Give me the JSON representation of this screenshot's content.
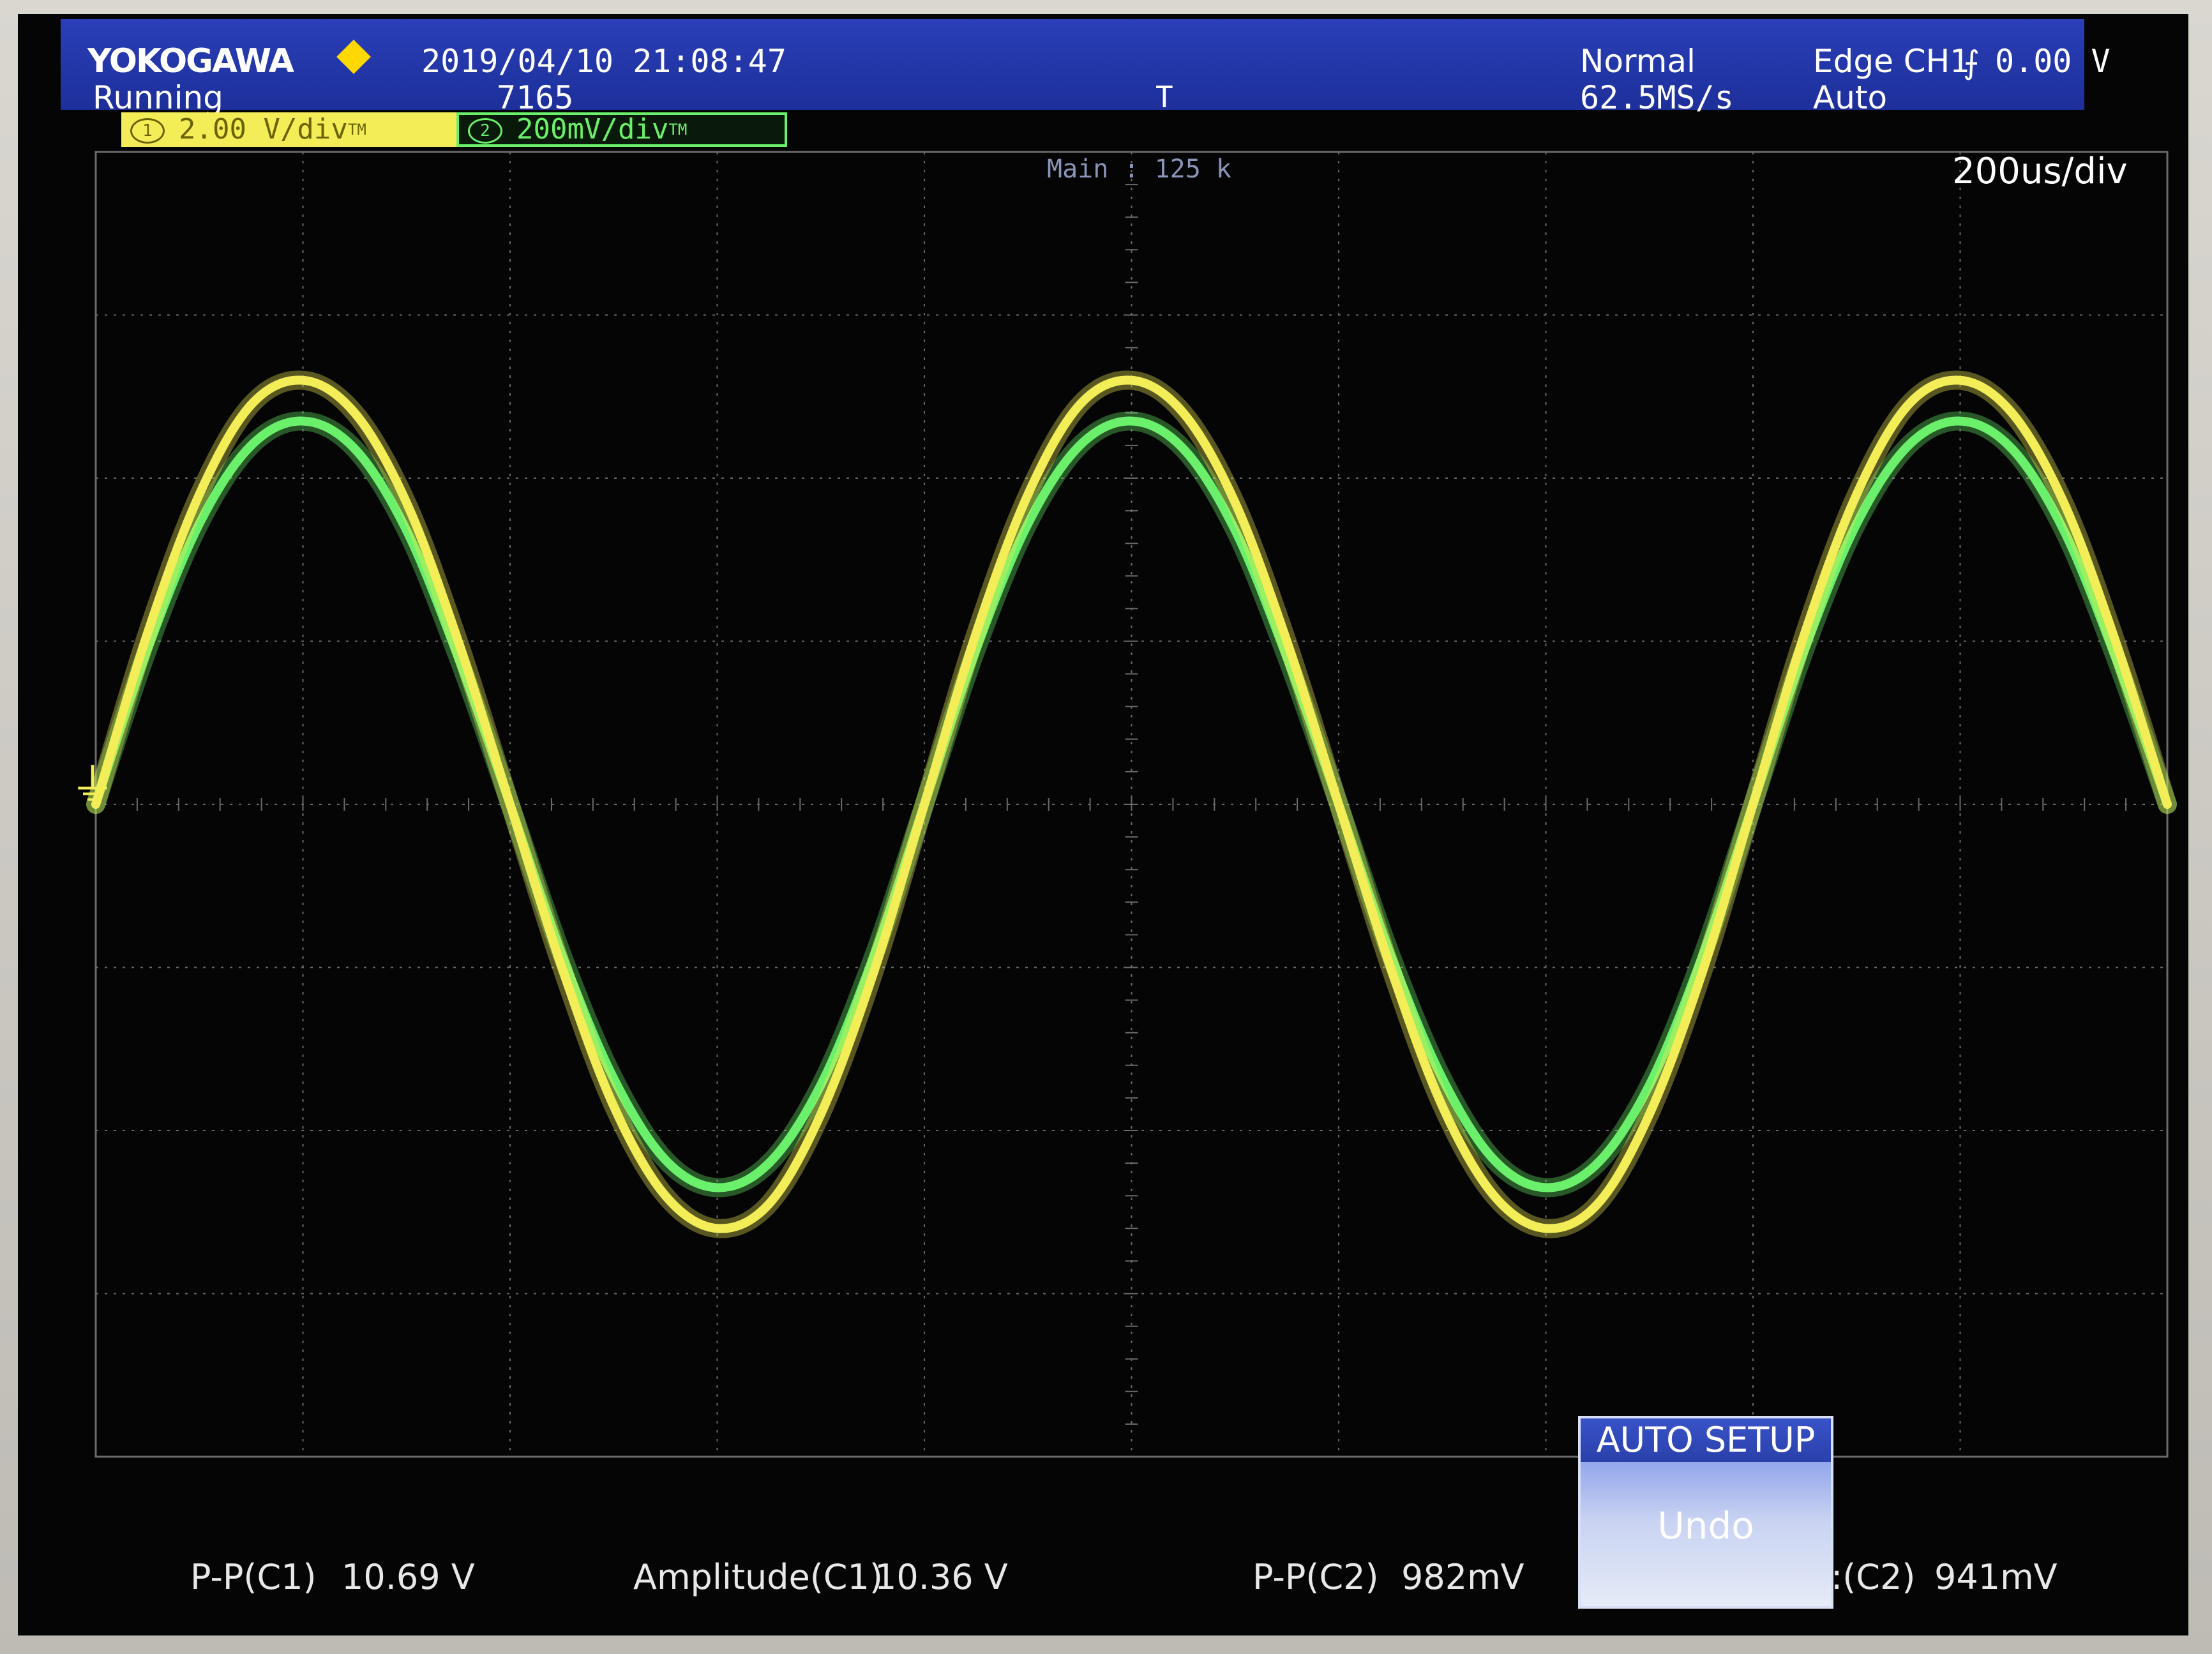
{
  "header": {
    "brand": "YOKOGAWA",
    "timestamp": "2019/04/10 21:08:47",
    "status": "Running",
    "acquisition_count": "7165",
    "trigger_mode": "Normal",
    "sample_rate": "62.5MS/s",
    "trigger_source": "Edge CH1",
    "trigger_level": "0.00 V",
    "trigger_auto": "Auto",
    "icons": {
      "brand_mark": "yellow-diamond-icon",
      "trigger_position": "trigger-position-icon",
      "trigger_slope": "rising-edge-icon"
    }
  },
  "channels": {
    "ch1": {
      "number": "1",
      "scale": "2.00 V/div",
      "tm": "TM",
      "color": "#f3ee57"
    },
    "ch2": {
      "number": "2",
      "scale": "200mV/div",
      "tm": "TM",
      "color": "#6bf06b"
    }
  },
  "display": {
    "zoom_label": "Main : 125 k",
    "timebase": "200us/div",
    "ground_marker_icon": "ground-icon",
    "grid_color": "#6a6a6a",
    "background_color": "#050505"
  },
  "chart_data": {
    "type": "line",
    "title": "",
    "xlabel": "",
    "ylabel": "",
    "x_divisions": 10,
    "y_divisions": 8,
    "xlim": [
      0,
      10
    ],
    "ylim": [
      -4,
      4
    ],
    "grid": true,
    "series": [
      {
        "name": "CH1",
        "color": "#f3ee57",
        "x": [
          0,
          0.25,
          0.5,
          0.75,
          1.0,
          1.25,
          1.5,
          1.75,
          2.0,
          2.25,
          2.5,
          2.75,
          3.0,
          3.25,
          3.5,
          3.75,
          4.0,
          4.25,
          4.5,
          4.75,
          5.0,
          5.25,
          5.5,
          5.75,
          6.0,
          6.25,
          6.5,
          6.75,
          7.0,
          7.25,
          7.5,
          7.75,
          8.0,
          8.25,
          8.5,
          8.75,
          9.0,
          9.25,
          9.5,
          9.75,
          10.0
        ],
        "y": [
          0.0,
          1.05,
          1.9,
          2.45,
          2.6,
          2.4,
          1.85,
          1.0,
          0.0,
          -1.0,
          -1.85,
          -2.4,
          -2.6,
          -2.45,
          -1.9,
          -1.05,
          0.0,
          1.05,
          1.9,
          2.45,
          2.6,
          2.4,
          1.85,
          1.0,
          0.0,
          -1.0,
          -1.85,
          -2.4,
          -2.6,
          -2.45,
          -1.9,
          -1.05,
          0.0,
          1.05,
          1.9,
          2.45,
          2.6,
          2.4,
          1.85,
          1.0,
          0.0
        ]
      },
      {
        "name": "CH2",
        "color": "#6bf06b",
        "x": [
          0,
          0.25,
          0.5,
          0.75,
          1.0,
          1.25,
          1.5,
          1.75,
          2.0,
          2.25,
          2.5,
          2.75,
          3.0,
          3.25,
          3.5,
          3.75,
          4.0,
          4.25,
          4.5,
          4.75,
          5.0,
          5.25,
          5.5,
          5.75,
          6.0,
          6.25,
          6.5,
          6.75,
          7.0,
          7.25,
          7.5,
          7.75,
          8.0,
          8.25,
          8.5,
          8.75,
          9.0,
          9.25,
          9.5,
          9.75,
          10.0
        ],
        "y": [
          0.0,
          0.95,
          1.72,
          2.2,
          2.35,
          2.18,
          1.68,
          0.9,
          0.0,
          -0.92,
          -1.68,
          -2.18,
          -2.35,
          -2.2,
          -1.72,
          -0.95,
          0.0,
          0.95,
          1.72,
          2.2,
          2.35,
          2.18,
          1.68,
          0.9,
          0.0,
          -0.92,
          -1.68,
          -2.18,
          -2.35,
          -2.2,
          -1.72,
          -0.95,
          0.0,
          0.95,
          1.72,
          2.2,
          2.35,
          2.18,
          1.68,
          0.9,
          0.0
        ]
      }
    ]
  },
  "measurements": [
    {
      "label": "P-P(C1)",
      "value": "10.69 V"
    },
    {
      "label": "Amplitude(C1)",
      "value": "10.36 V"
    },
    {
      "label": "P-P(C2)",
      "value": "982mV"
    },
    {
      "label": ":(C2)",
      "value": "941mV"
    }
  ],
  "auto_setup": {
    "title": "AUTO SETUP",
    "undo_label": "Undo"
  }
}
